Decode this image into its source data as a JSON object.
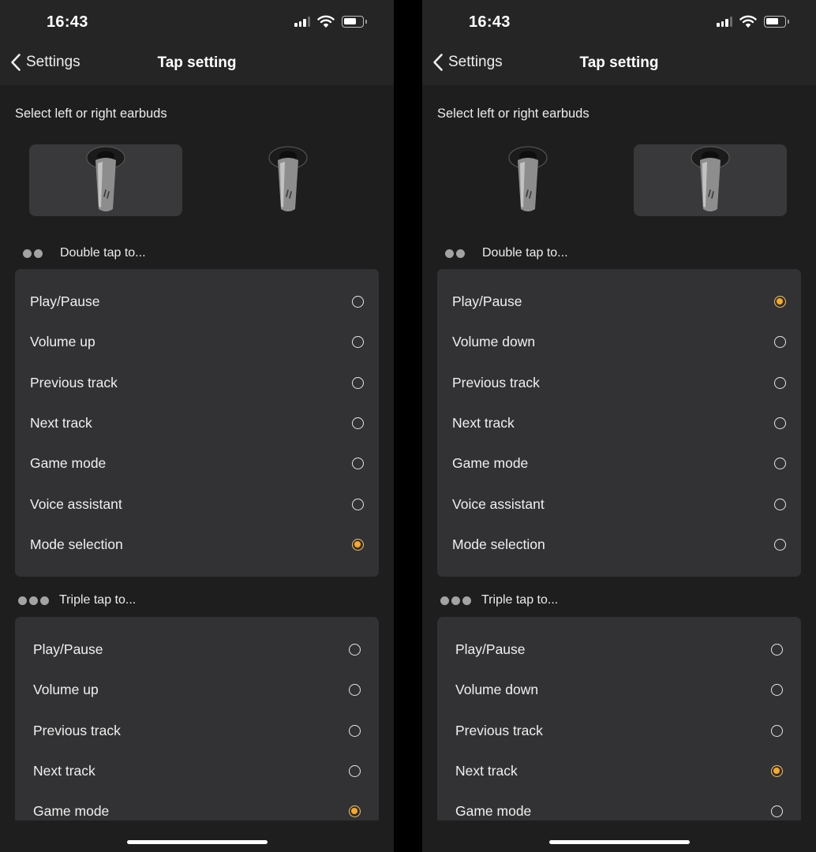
{
  "screens": [
    {
      "status": {
        "time": "16:43"
      },
      "nav": {
        "back_label": "Settings",
        "title": "Tap setting"
      },
      "earbud_prompt": "Select left or right earbuds",
      "selected_earbud": "left",
      "double_tap": {
        "label": "Double tap to...",
        "options": [
          {
            "label": "Play/Pause",
            "selected": false
          },
          {
            "label": "Volume up",
            "selected": false
          },
          {
            "label": "Previous track",
            "selected": false
          },
          {
            "label": "Next track",
            "selected": false
          },
          {
            "label": "Game mode",
            "selected": false
          },
          {
            "label": "Voice assistant",
            "selected": false
          },
          {
            "label": "Mode selection",
            "selected": true
          }
        ]
      },
      "triple_tap": {
        "label": "Triple tap to...",
        "options": [
          {
            "label": "Play/Pause",
            "selected": false
          },
          {
            "label": "Volume up",
            "selected": false
          },
          {
            "label": "Previous track",
            "selected": false
          },
          {
            "label": "Next track",
            "selected": false
          },
          {
            "label": "Game mode",
            "selected": true
          }
        ]
      }
    },
    {
      "status": {
        "time": "16:43"
      },
      "nav": {
        "back_label": "Settings",
        "title": "Tap setting"
      },
      "earbud_prompt": "Select left or right earbuds",
      "selected_earbud": "right",
      "double_tap": {
        "label": "Double tap to...",
        "options": [
          {
            "label": "Play/Pause",
            "selected": true
          },
          {
            "label": "Volume down",
            "selected": false
          },
          {
            "label": "Previous track",
            "selected": false
          },
          {
            "label": "Next track",
            "selected": false
          },
          {
            "label": "Game mode",
            "selected": false
          },
          {
            "label": "Voice assistant",
            "selected": false
          },
          {
            "label": "Mode selection",
            "selected": false
          }
        ]
      },
      "triple_tap": {
        "label": "Triple tap to...",
        "options": [
          {
            "label": "Play/Pause",
            "selected": false
          },
          {
            "label": "Volume down",
            "selected": false
          },
          {
            "label": "Previous track",
            "selected": false
          },
          {
            "label": "Next track",
            "selected": true
          },
          {
            "label": "Game mode",
            "selected": false
          }
        ]
      }
    }
  ],
  "icons": {
    "back": "chevron-left-icon",
    "cellular": "signal-bars-icon",
    "wifi": "wifi-icon",
    "battery": "battery-icon",
    "earbud": "earbud-icon",
    "double_tap": "double-dot-icon",
    "triple_tap": "triple-dot-icon"
  },
  "colors": {
    "background": "#1e1e1f",
    "header": "#252526",
    "card": "#323234",
    "selected_tile": "#39393b",
    "accent_radio": "#f0a93b"
  }
}
